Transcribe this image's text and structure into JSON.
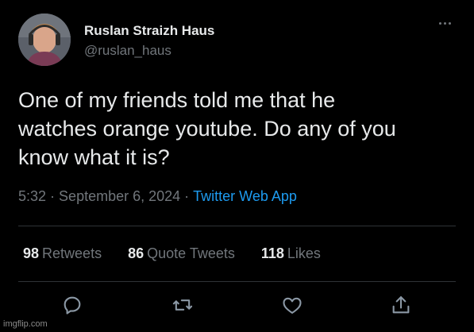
{
  "author": {
    "display_name": "Ruslan Straizh Haus",
    "handle": "@ruslan_haus",
    "avatar_icon": "avatar-photo"
  },
  "tweet": {
    "text_lines": [
      "One of my friends told me that he",
      "watches orange youtube. Do any of you",
      "know what it is?"
    ],
    "time": "5:32",
    "separator": "·",
    "date": "September 6, 2024",
    "source": "Twitter Web App"
  },
  "stats": {
    "retweets_count": "98",
    "retweets_label": "Retweets",
    "quote_count": "86",
    "quote_label": "Quote Tweets",
    "likes_count": "118",
    "likes_label": "Likes"
  },
  "actions": {
    "icons": [
      "reply-icon",
      "retweet-icon",
      "like-icon",
      "share-icon"
    ]
  },
  "watermark": "imgflip.com",
  "colors": {
    "background": "#000000",
    "text": "#e7e9ea",
    "muted": "#71767b",
    "link": "#1d9bf0",
    "divider": "#2f3336"
  }
}
